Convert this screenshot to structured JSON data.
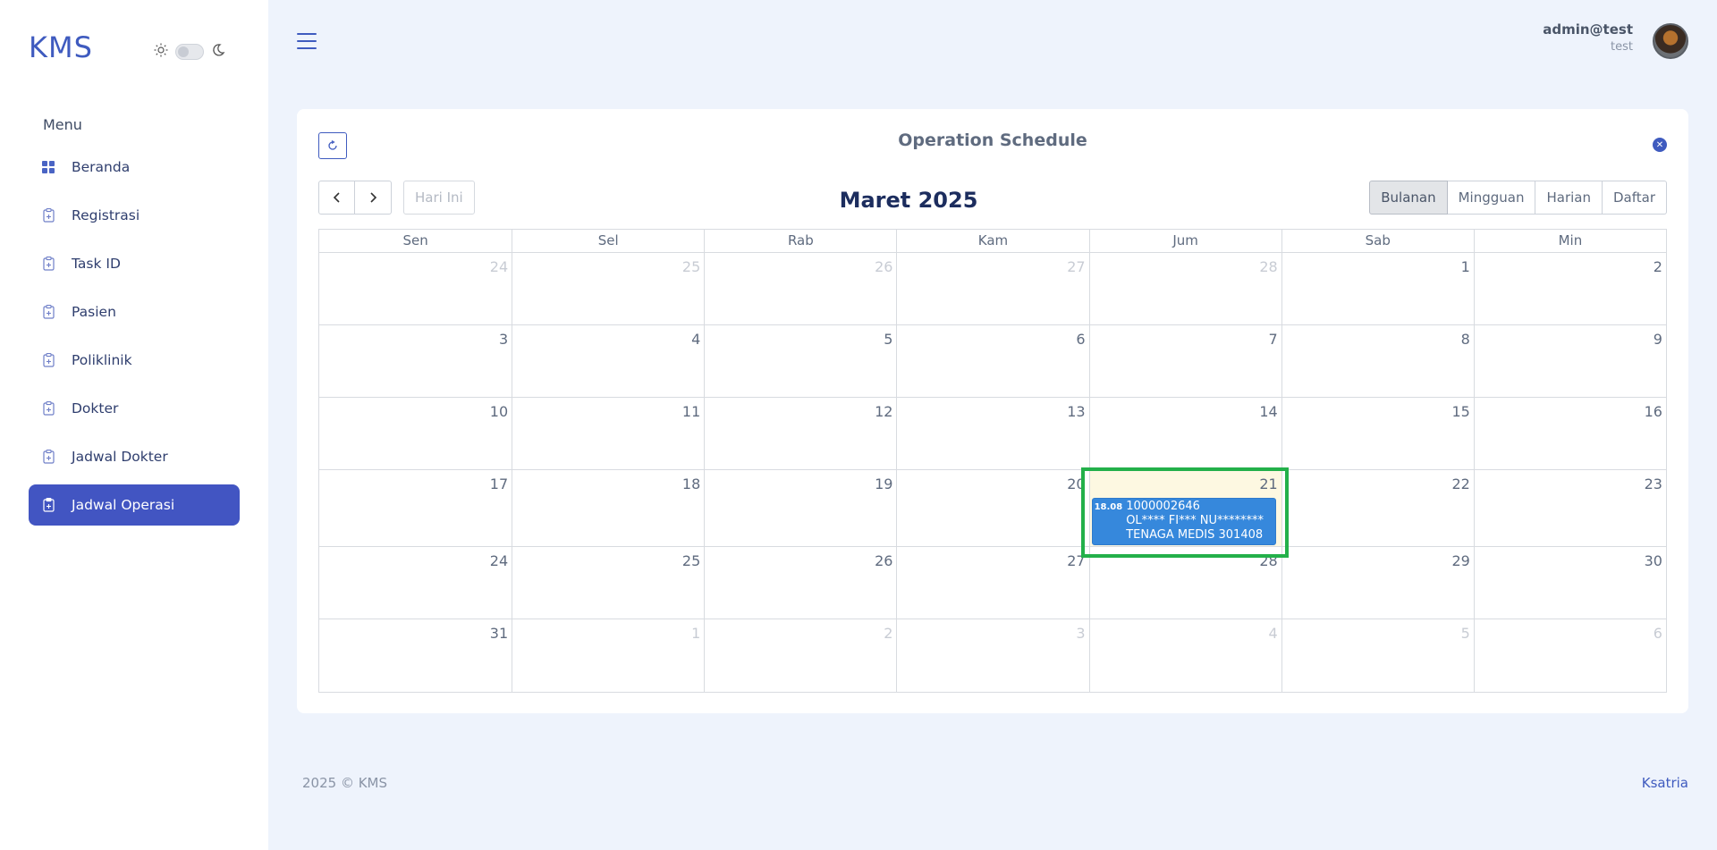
{
  "app": {
    "logo": "KMS"
  },
  "sidebar": {
    "menu_title": "Menu",
    "items": [
      {
        "label": "Beranda",
        "icon": "grid-icon",
        "active": false
      },
      {
        "label": "Registrasi",
        "icon": "clipboard-icon",
        "active": false
      },
      {
        "label": "Task ID",
        "icon": "clipboard-icon",
        "active": false
      },
      {
        "label": "Pasien",
        "icon": "clipboard-icon",
        "active": false
      },
      {
        "label": "Poliklinik",
        "icon": "clipboard-icon",
        "active": false
      },
      {
        "label": "Dokter",
        "icon": "clipboard-icon",
        "active": false
      },
      {
        "label": "Jadwal Dokter",
        "icon": "clipboard-icon",
        "active": false
      },
      {
        "label": "Jadwal Operasi",
        "icon": "clipboard-icon",
        "active": true
      }
    ]
  },
  "header": {
    "user_name": "admin@test",
    "user_role": "test"
  },
  "card": {
    "title": "Operation Schedule",
    "today_label": "Hari Ini",
    "month_title": "Maret 2025",
    "views": [
      {
        "label": "Bulanan",
        "active": true
      },
      {
        "label": "Mingguan",
        "active": false
      },
      {
        "label": "Harian",
        "active": false
      },
      {
        "label": "Daftar",
        "active": false
      }
    ]
  },
  "calendar": {
    "weekdays": [
      "Sen",
      "Sel",
      "Rab",
      "Kam",
      "Jum",
      "Sab",
      "Min"
    ],
    "weeks": [
      [
        {
          "d": "24",
          "m": true
        },
        {
          "d": "25",
          "m": true
        },
        {
          "d": "26",
          "m": true
        },
        {
          "d": "27",
          "m": true
        },
        {
          "d": "28",
          "m": true
        },
        {
          "d": "1"
        },
        {
          "d": "2"
        }
      ],
      [
        {
          "d": "3"
        },
        {
          "d": "4"
        },
        {
          "d": "5"
        },
        {
          "d": "6"
        },
        {
          "d": "7"
        },
        {
          "d": "8"
        },
        {
          "d": "9"
        }
      ],
      [
        {
          "d": "10"
        },
        {
          "d": "11"
        },
        {
          "d": "12"
        },
        {
          "d": "13"
        },
        {
          "d": "14"
        },
        {
          "d": "15"
        },
        {
          "d": "16"
        }
      ],
      [
        {
          "d": "17"
        },
        {
          "d": "18"
        },
        {
          "d": "19"
        },
        {
          "d": "20"
        },
        {
          "d": "21",
          "today": true
        },
        {
          "d": "22"
        },
        {
          "d": "23"
        }
      ],
      [
        {
          "d": "24"
        },
        {
          "d": "25"
        },
        {
          "d": "26"
        },
        {
          "d": "27"
        },
        {
          "d": "28"
        },
        {
          "d": "29"
        },
        {
          "d": "30"
        }
      ],
      [
        {
          "d": "31"
        },
        {
          "d": "1",
          "m": true
        },
        {
          "d": "2",
          "m": true
        },
        {
          "d": "3",
          "m": true
        },
        {
          "d": "4",
          "m": true
        },
        {
          "d": "5",
          "m": true
        },
        {
          "d": "6",
          "m": true
        }
      ]
    ],
    "event": {
      "time": "18.08",
      "lines": [
        "1000002646",
        "OL**** FI*** NU********",
        "TENAGA MEDIS 301408"
      ]
    }
  },
  "footer": {
    "copyright": "2025 © KMS",
    "credit": "Ksatria"
  },
  "colors": {
    "accent": "#4255c2",
    "event": "#3688dc",
    "today": "#fdf8e1",
    "highlight": "#23b04a"
  }
}
